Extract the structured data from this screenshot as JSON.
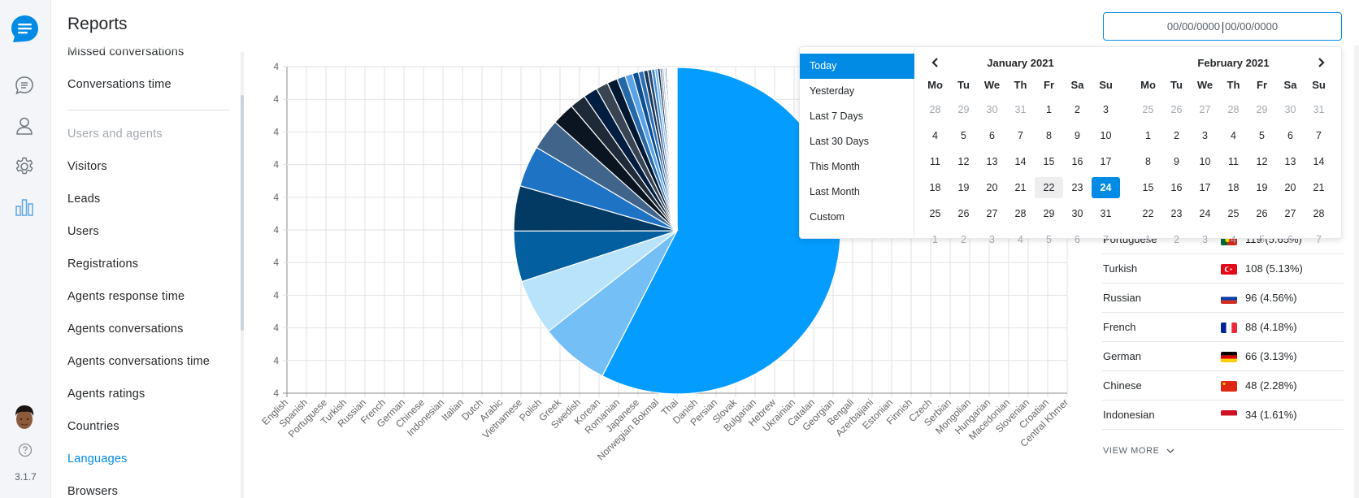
{
  "app": {
    "version": "3.1.7",
    "brand_color": "#028be5"
  },
  "rail": {
    "icons": [
      "chat-logo-icon",
      "conversations-icon",
      "users-icon",
      "settings-icon",
      "reports-icon"
    ],
    "help_icon": "help-icon"
  },
  "nav": {
    "title": "Reports",
    "partial_item": "Missed conversations",
    "items_top": [
      "Conversations time"
    ],
    "group_label": "Users and agents",
    "items": [
      "Visitors",
      "Leads",
      "Users",
      "Registrations",
      "Agents response time",
      "Agents conversations",
      "Agents conversations time",
      "Agents ratings",
      "Countries",
      "Languages",
      "Browsers"
    ],
    "active": "Languages"
  },
  "date_range": {
    "placeholder": "00/00/0000",
    "separator": "-",
    "start": "00/00/0000",
    "end": "00/00/0000"
  },
  "date_picker": {
    "ranges": [
      "Today",
      "Yesterday",
      "Last 7 Days",
      "Last 30 Days",
      "This Month",
      "Last Month",
      "Custom"
    ],
    "active_range": "Today",
    "weekdays": [
      "Mo",
      "Tu",
      "We",
      "Th",
      "Fr",
      "Sa",
      "Su"
    ],
    "months": [
      {
        "title": "January 2021",
        "days": [
          [
            "28",
            "29",
            "30",
            "31",
            "1",
            "2",
            "3"
          ],
          [
            "4",
            "5",
            "6",
            "7",
            "8",
            "9",
            "10"
          ],
          [
            "11",
            "12",
            "13",
            "14",
            "15",
            "16",
            "17"
          ],
          [
            "18",
            "19",
            "20",
            "21",
            "22",
            "23",
            "24"
          ],
          [
            "25",
            "26",
            "27",
            "28",
            "29",
            "30",
            "31"
          ],
          [
            "1",
            "2",
            "3",
            "4",
            "5",
            "6",
            "7"
          ]
        ],
        "off": [
          [
            0,
            0
          ],
          [
            0,
            1
          ],
          [
            0,
            2
          ],
          [
            0,
            3
          ],
          [
            5,
            0
          ],
          [
            5,
            1
          ],
          [
            5,
            2
          ],
          [
            5,
            3
          ],
          [
            5,
            4
          ],
          [
            5,
            5
          ],
          [
            5,
            6
          ]
        ],
        "hover": [
          3,
          4
        ],
        "selected": [
          3,
          6
        ]
      },
      {
        "title": "February 2021",
        "days": [
          [
            "25",
            "26",
            "27",
            "28",
            "29",
            "30",
            "31"
          ],
          [
            "1",
            "2",
            "3",
            "4",
            "5",
            "6",
            "7"
          ],
          [
            "8",
            "9",
            "10",
            "11",
            "12",
            "13",
            "14"
          ],
          [
            "15",
            "16",
            "17",
            "18",
            "19",
            "20",
            "21"
          ],
          [
            "22",
            "23",
            "24",
            "25",
            "26",
            "27",
            "28"
          ],
          [
            "1",
            "2",
            "3",
            "4",
            "5",
            "6",
            "7"
          ]
        ],
        "off": [
          [
            0,
            0
          ],
          [
            0,
            1
          ],
          [
            0,
            2
          ],
          [
            0,
            3
          ],
          [
            0,
            4
          ],
          [
            0,
            5
          ],
          [
            0,
            6
          ],
          [
            5,
            0
          ],
          [
            5,
            1
          ],
          [
            5,
            2
          ],
          [
            5,
            3
          ],
          [
            5,
            4
          ],
          [
            5,
            5
          ],
          [
            5,
            6
          ]
        ],
        "hover": null,
        "selected": null
      }
    ]
  },
  "language_list": {
    "rows": [
      {
        "label": "Portuguese",
        "value": "119 (5.65%)",
        "flag": "portugal-flag-icon"
      },
      {
        "label": "Turkish",
        "value": "108 (5.13%)",
        "flag": "turkey-flag-icon"
      },
      {
        "label": "Russian",
        "value": "96 (4.56%)",
        "flag": "russia-flag-icon"
      },
      {
        "label": "French",
        "value": "88 (4.18%)",
        "flag": "france-flag-icon"
      },
      {
        "label": "German",
        "value": "66 (3.13%)",
        "flag": "germany-flag-icon"
      },
      {
        "label": "Chinese",
        "value": "48 (2.28%)",
        "flag": "china-flag-icon"
      },
      {
        "label": "Indonesian",
        "value": "34 (1.61%)",
        "flag": "indonesia-flag-icon"
      }
    ],
    "view_more": "VIEW MORE"
  },
  "chart_data": {
    "type": "pie",
    "title": "",
    "xlabel": "",
    "ylabel": "",
    "grid": true,
    "y_tick_labels": [
      "4",
      "4",
      "4",
      "4",
      "4",
      "4",
      "4",
      "4",
      "4",
      "4",
      "4"
    ],
    "categories": [
      "English",
      "Spanish",
      "Portuguese",
      "Turkish",
      "Russian",
      "French",
      "German",
      "Chinese",
      "Indonesian",
      "Italian",
      "Dutch",
      "Arabic",
      "Vietnamese",
      "Polish",
      "Greek",
      "Swedish",
      "Korean",
      "Romanian",
      "Japanese",
      "Norwegian Bokmal",
      "Thai",
      "Danish",
      "Persian",
      "Slovak",
      "Bulgarian",
      "Hebrew",
      "Ukrainian",
      "Catalan",
      "Georgian",
      "Bengali",
      "Azerbaijani",
      "Estonian",
      "Finnish",
      "Czech",
      "Serbian",
      "Mongolian",
      "Hungarian",
      "Macedonian",
      "Slovenian",
      "Croatian",
      "Central Khmer"
    ],
    "values": [
      1240,
      148,
      119,
      108,
      96,
      88,
      66,
      48,
      34,
      30,
      26,
      22,
      18,
      16,
      13,
      11,
      9,
      8,
      7,
      6,
      5,
      4,
      4,
      3,
      3,
      2,
      2,
      2,
      2,
      2,
      2,
      1,
      1,
      1,
      1,
      1,
      1,
      1,
      1,
      1,
      1
    ],
    "colors": [
      "#049cff",
      "#74bff5",
      "#b9e2fb",
      "#045fa0",
      "#033a63",
      "#1f73c5",
      "#41658a",
      "#0b1521",
      "#1e2a37",
      "#011e41",
      "#384451",
      "#021730",
      "#2468a8",
      "#5aa3e8",
      "#0d4f93",
      "#2e6fb1",
      "#17365a",
      "#274b73",
      "#3e8ad6",
      "#76b3ee",
      "#0a2440",
      "#5a6a7a",
      "#8fb8e0",
      "#c4d7ea",
      "#1b2b3d",
      "#a8c8e8",
      "#d8e6f4",
      "#6f8aa6",
      "#e6eef6",
      "#b3c3d3",
      "#9cc3ea",
      "#ced9e4",
      "#f0f4f8",
      "#dfe7ef",
      "#c9d3de",
      "#e9eff5",
      "#f4f7fa",
      "#d2dde8",
      "#eaf0f6",
      "#f6f8fa",
      "#fafbfc"
    ],
    "legend": "none"
  }
}
